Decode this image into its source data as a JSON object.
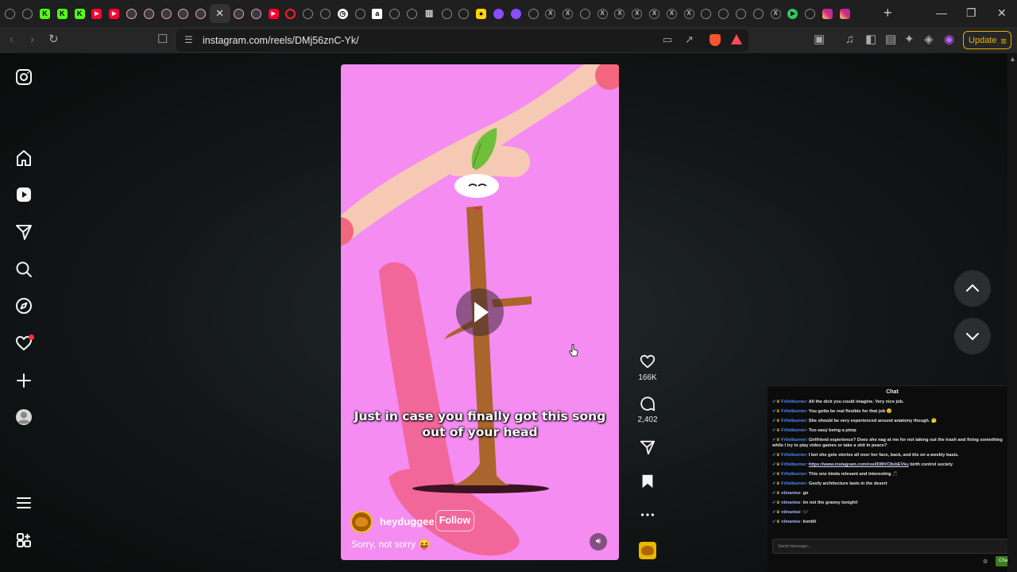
{
  "browser": {
    "tabs": [
      {
        "icon": "generic-globe-icon",
        "type": "generic"
      },
      {
        "icon": "generic-globe-icon",
        "type": "generic"
      },
      {
        "icon": "kick-icon",
        "type": "kick",
        "glyph": "K"
      },
      {
        "icon": "kick-icon",
        "type": "kick",
        "glyph": "K"
      },
      {
        "icon": "kick-logo-icon",
        "type": "kick",
        "glyph": "K"
      },
      {
        "icon": "youtube-icon",
        "type": "yt",
        "glyph": "▶"
      },
      {
        "icon": "youtube-icon",
        "type": "yt",
        "glyph": "▶"
      },
      {
        "icon": "instagram-icon",
        "type": "ig"
      },
      {
        "icon": "instagram-icon",
        "type": "ig"
      },
      {
        "icon": "instagram-icon",
        "type": "ig"
      },
      {
        "icon": "instagram-icon",
        "type": "ig"
      },
      {
        "icon": "instagram-icon",
        "type": "ig"
      },
      {
        "icon": "close-icon",
        "type": "active"
      },
      {
        "icon": "instagram-icon",
        "type": "ig"
      },
      {
        "icon": "instagram-icon",
        "type": "ig"
      },
      {
        "icon": "youtube-icon",
        "type": "yt",
        "glyph": "▶"
      },
      {
        "icon": "opera-icon",
        "type": "opera"
      },
      {
        "icon": "generic-globe-icon",
        "type": "generic"
      },
      {
        "icon": "generic-globe-icon",
        "type": "generic"
      },
      {
        "icon": "clock-icon",
        "type": "dark",
        "glyph": "◷"
      },
      {
        "icon": "generic-globe-icon",
        "type": "generic"
      },
      {
        "icon": "amazon-icon",
        "type": "amz",
        "glyph": "a"
      },
      {
        "icon": "generic-globe-icon",
        "type": "generic"
      },
      {
        "icon": "generic-globe-icon",
        "type": "generic"
      },
      {
        "icon": "trash-icon",
        "type": "bin",
        "glyph": "▥"
      },
      {
        "icon": "generic-globe-icon",
        "type": "generic"
      },
      {
        "icon": "generic-globe-icon",
        "type": "generic"
      },
      {
        "icon": "yellow-app-icon",
        "type": "yellow",
        "glyph": "●"
      },
      {
        "icon": "purple-app-icon",
        "type": "purple"
      },
      {
        "icon": "purple-app-icon",
        "type": "purple"
      },
      {
        "icon": "generic-globe-icon",
        "type": "generic"
      },
      {
        "icon": "x-icon",
        "type": "x",
        "glyph": "X"
      },
      {
        "icon": "x-icon",
        "type": "x",
        "glyph": "X"
      },
      {
        "icon": "generic-globe-icon",
        "type": "generic"
      },
      {
        "icon": "x-icon",
        "type": "x",
        "glyph": "X"
      },
      {
        "icon": "x-icon",
        "type": "x",
        "glyph": "X"
      },
      {
        "icon": "x-icon",
        "type": "x",
        "glyph": "X"
      },
      {
        "icon": "x-icon",
        "type": "x",
        "glyph": "X"
      },
      {
        "icon": "x-icon",
        "type": "x",
        "glyph": "X"
      },
      {
        "icon": "x-icon",
        "type": "x",
        "glyph": "X"
      },
      {
        "icon": "generic-globe-icon",
        "type": "generic"
      },
      {
        "icon": "generic-globe-icon",
        "type": "generic"
      },
      {
        "icon": "generic-globe-icon",
        "type": "generic"
      },
      {
        "icon": "generic-globe-icon",
        "type": "generic"
      },
      {
        "icon": "x-icon",
        "type": "x",
        "glyph": "X"
      },
      {
        "icon": "play-app-icon",
        "type": "play",
        "glyph": "▶"
      },
      {
        "icon": "generic-globe-icon",
        "type": "generic"
      },
      {
        "icon": "instagram-color-icon",
        "type": "igc"
      },
      {
        "icon": "instagram-color-icon",
        "type": "igc"
      }
    ],
    "new_tab_glyph": "+",
    "window_controls": {
      "minimize": "—",
      "maximize": "❐",
      "close": "✕"
    },
    "url": "instagram.com/reels/DMj56znC-Yk/",
    "update_label": "Update",
    "accent": "#e5b800"
  },
  "sidebar": {
    "items": [
      "instagram-logo-icon",
      "home-icon",
      "reels-icon",
      "messages-icon",
      "search-icon",
      "explore-icon",
      "notifications-icon",
      "create-icon",
      "profile-icon",
      "more-menu-icon",
      "threads-icon"
    ]
  },
  "reel": {
    "caption": "Just in case you finally got this song out of your head",
    "username": "heyduggee",
    "follow_label": "Follow",
    "description": "Sorry, not sorry 😝",
    "background_color": "#f48cf2"
  },
  "actions": {
    "likes": "166K",
    "comments": "2,402"
  },
  "chat": {
    "title": "Chat",
    "messages": [
      {
        "user": "Fr0stburner",
        "text": "All the dick you could imagine. Very nice job."
      },
      {
        "user": "Fr0stburner",
        "text": "You gotta be real flexible for that job 😉"
      },
      {
        "user": "Fr0stburner",
        "text": "She should be very experienced around anatomy though. 🤔"
      },
      {
        "user": "Fr0stburner",
        "text": "Too easy being a pimp"
      },
      {
        "user": "Fr0stburner",
        "text": "Girlfriend experience? Does she nag at me for not taking out the trash and fixing something while I try to play video games or take a shit in peace?"
      },
      {
        "user": "Fr0stburner",
        "text": "I bet she gets stories all over her face, back, and tits on a weekly basis."
      },
      {
        "user": "Fr0stburner",
        "link": "https://www.instagram.com/reel/DMVC8sbEVku",
        "text": "birth control society"
      },
      {
        "user": "Fr0stburner",
        "text": "This one kinda relevant and interesting 🎵"
      },
      {
        "user": "Fr0stburner",
        "text": "Goofy architecture lasts in the desert"
      },
      {
        "user": "niinanise",
        "text": "gn",
        "alt": true
      },
      {
        "user": "niinanise",
        "text": "im not the granny tonight!",
        "alt": true
      },
      {
        "user": "niinanise",
        "text": "🎶",
        "alt": true
      },
      {
        "user": "niinanise",
        "text": "kontiii",
        "alt": true
      }
    ],
    "input_placeholder": "Send message...",
    "send_label": "Chat"
  }
}
